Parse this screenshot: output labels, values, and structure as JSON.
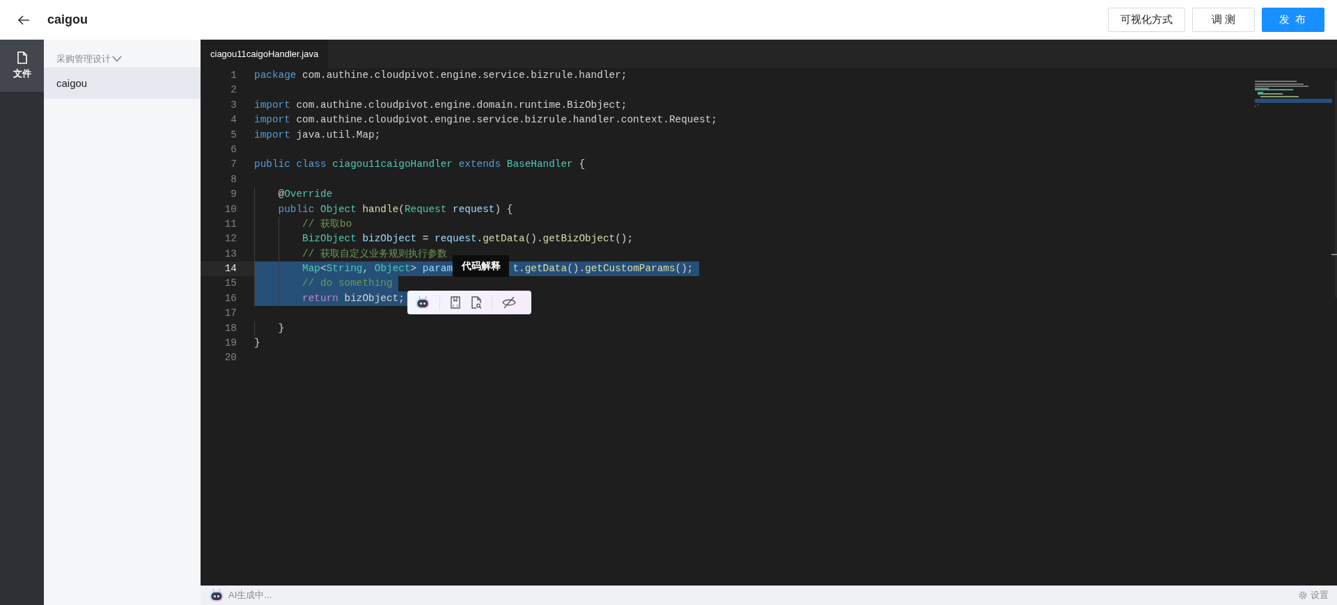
{
  "header": {
    "title": "caigou",
    "buttons": [
      {
        "label": "可视化方式",
        "kind": "default"
      },
      {
        "label": "调 测",
        "kind": "default"
      },
      {
        "label": "发 布",
        "kind": "primary"
      }
    ]
  },
  "rail": [
    {
      "label": "文件",
      "selected": true
    }
  ],
  "tree": {
    "title": "采购管理设计",
    "items": [
      {
        "label": "caigou",
        "selected": true
      }
    ]
  },
  "tabs": [
    {
      "label": "ciagou11caigoHandler.java",
      "selected": true
    }
  ],
  "code": [
    {
      "number": "1",
      "selected": false,
      "current": false,
      "tokens": [
        {
          "kind": "keyword",
          "text": "package"
        },
        {
          "kind": "plain",
          "text": " com.authine.cloudpivot.engine.service.bizrule.handler;"
        }
      ]
    },
    {
      "number": "2",
      "selected": false,
      "current": false
    },
    {
      "number": "3",
      "selected": false,
      "current": false,
      "tokens": [
        {
          "kind": "keyword",
          "text": "import"
        },
        {
          "kind": "plain",
          "text": " com.authine.cloudpivot.engine.domain.runtime.BizObject;"
        }
      ]
    },
    {
      "number": "4",
      "selected": false,
      "current": false,
      "tokens": [
        {
          "kind": "keyword",
          "text": "import"
        },
        {
          "kind": "plain",
          "text": " com.authine.cloudpivot.engine.service.bizrule.handler.context.Request;"
        }
      ]
    },
    {
      "number": "5",
      "selected": false,
      "current": false,
      "tokens": [
        {
          "kind": "keyword",
          "text": "import"
        },
        {
          "kind": "plain",
          "text": " java.util.Map;"
        }
      ]
    },
    {
      "number": "6",
      "selected": false,
      "current": false
    },
    {
      "number": "7",
      "selected": false,
      "current": false,
      "tokens": [
        {
          "kind": "keyword",
          "text": "public"
        },
        {
          "kind": "keyword",
          "text": " class"
        },
        {
          "kind": "type",
          "text": " ciagou11caigoHandler"
        },
        {
          "kind": "keyword",
          "text": " extends"
        },
        {
          "kind": "type",
          "text": " BaseHandler"
        },
        {
          "kind": "plain",
          "text": " {"
        }
      ]
    },
    {
      "number": "8",
      "selected": false,
      "current": false
    },
    {
      "number": "9",
      "selected": false,
      "current": false,
      "tokens": [
        {
          "kind": "plain",
          "text": "    @"
        },
        {
          "kind": "type",
          "text": "Override"
        }
      ]
    },
    {
      "number": "10",
      "selected": false,
      "current": false,
      "tokens": [
        {
          "kind": "keyword",
          "text": "    public"
        },
        {
          "kind": "type",
          "text": " Object"
        },
        {
          "kind": "function",
          "text": " handle"
        },
        {
          "kind": "plain",
          "text": "("
        },
        {
          "kind": "type",
          "text": "Request"
        },
        {
          "kind": "variable",
          "text": " request"
        },
        {
          "kind": "plain",
          "text": ") {"
        }
      ]
    },
    {
      "number": "11",
      "selected": false,
      "current": false,
      "tokens": [
        {
          "kind": "comment",
          "text": "        // 获取bo"
        }
      ]
    },
    {
      "number": "12",
      "selected": false,
      "current": false,
      "tokens": [
        {
          "kind": "type",
          "text": "        BizObject"
        },
        {
          "kind": "variable",
          "text": " bizObject"
        },
        {
          "kind": "plain",
          "text": " = "
        },
        {
          "kind": "variable",
          "text": "request"
        },
        {
          "kind": "plain",
          "text": "."
        },
        {
          "kind": "function",
          "text": "getData"
        },
        {
          "kind": "plain",
          "text": "()."
        },
        {
          "kind": "function",
          "text": "getBizObject"
        },
        {
          "kind": "plain",
          "text": "();"
        }
      ]
    },
    {
      "number": "13",
      "selected": false,
      "current": false,
      "tokens": [
        {
          "kind": "comment",
          "text": "        // 获取自定义业务规则执行参数"
        }
      ]
    },
    {
      "number": "14",
      "selected": true,
      "current": true,
      "tokens": [
        {
          "kind": "type",
          "text": "        Map"
        },
        {
          "kind": "plain",
          "text": "<"
        },
        {
          "kind": "type",
          "text": "String"
        },
        {
          "kind": "plain",
          "text": ", "
        },
        {
          "kind": "type",
          "text": "Object"
        },
        {
          "kind": "plain",
          "text": "> "
        },
        {
          "kind": "variable",
          "text": "param"
        },
        {
          "kind": "gap"
        },
        {
          "kind": "variable",
          "text": "t"
        },
        {
          "kind": "plain",
          "text": "."
        },
        {
          "kind": "function",
          "text": "getData"
        },
        {
          "kind": "plain",
          "text": "()."
        },
        {
          "kind": "function",
          "text": "getCustomParams"
        },
        {
          "kind": "plain",
          "text": "();"
        }
      ]
    },
    {
      "number": "15",
      "selected": true,
      "current": false,
      "tokens": [
        {
          "kind": "comment",
          "text": "        // do something"
        }
      ]
    },
    {
      "number": "16",
      "selected": true,
      "current": false,
      "tokens": [
        {
          "kind": "control",
          "text": "        return"
        },
        {
          "kind": "plain",
          "text": " bizObject;"
        }
      ]
    },
    {
      "number": "17",
      "selected": false,
      "current": false
    },
    {
      "number": "18",
      "selected": false,
      "current": false,
      "tokens": [
        {
          "kind": "plain",
          "text": "    }"
        }
      ]
    },
    {
      "number": "19",
      "selected": false,
      "current": false,
      "tokens": [
        {
          "kind": "plain",
          "text": "}"
        }
      ]
    },
    {
      "number": "20",
      "selected": false,
      "current": false
    }
  ],
  "tooltip": "代码解释",
  "status_bar": {
    "message": "AI生成中...",
    "settings": "设置"
  }
}
